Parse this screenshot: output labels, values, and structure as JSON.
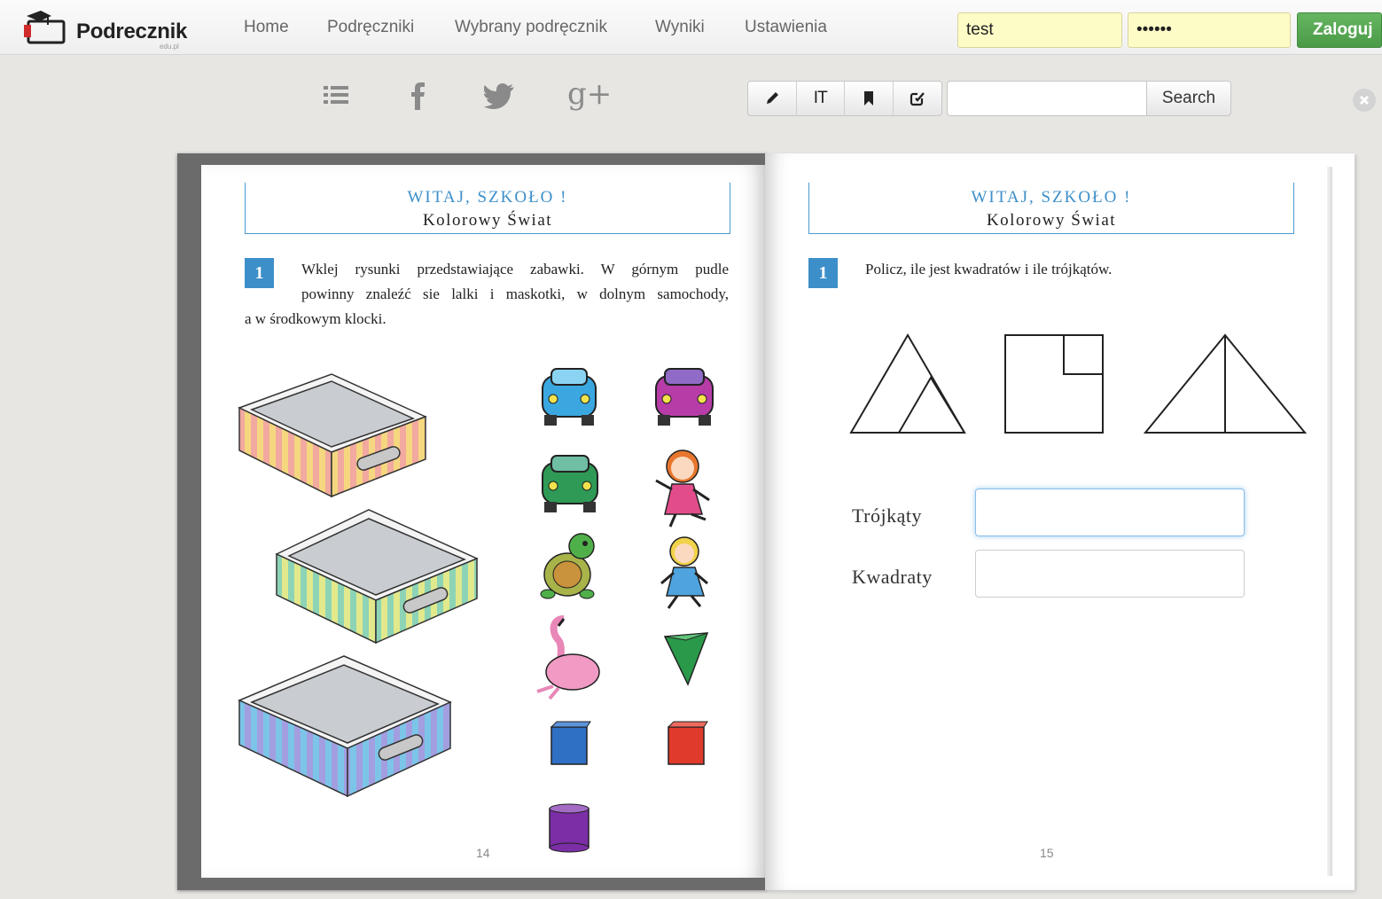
{
  "brand": {
    "name": "Podrecznik",
    "sub": "edu.pl"
  },
  "nav": [
    "Home",
    "Podręczniki",
    "Wybrany podręcznik",
    "Wyniki",
    "Ustawienia"
  ],
  "login": {
    "username": "test",
    "password": "••••••",
    "button": "Zaloguj"
  },
  "toolbar": {
    "social_icons": [
      "list-icon",
      "facebook-icon",
      "twitter-icon",
      "google-plus-icon"
    ],
    "tool_icons": [
      "pencil-icon",
      "text-cursor-icon",
      "bookmark-icon",
      "edit-check-icon"
    ],
    "tool_text_label": "IT",
    "google_plus_glyph": "g+",
    "search_value": "",
    "search_button": "Search"
  },
  "left_page": {
    "title": "WITAJ, SZKOŁO !",
    "subtitle": "Kolorowy Świat",
    "task_number": "1",
    "task_line1": "Wklej rysunki przedstawiające zabawki. W górnym pudle",
    "task_line2": "powinny znaleźć sie lalki i maskotki, w dolnym samochody,",
    "task_line3": "a w środkowym klocki.",
    "page_number": "14"
  },
  "right_page": {
    "title": "WITAJ, SZKOŁO !",
    "subtitle": "Kolorowy Świat",
    "task_number": "1",
    "task_text": "Policz, ile jest kwadratów i ile trójkątów.",
    "label_triangles": "Trójkąty",
    "label_squares": "Kwadraty",
    "triangles_value": "",
    "squares_value": "",
    "page_number": "15"
  },
  "colors": {
    "accent_blue": "#3d8fc9",
    "login_green": "#55a652",
    "login_field": "#fdfbc6"
  }
}
